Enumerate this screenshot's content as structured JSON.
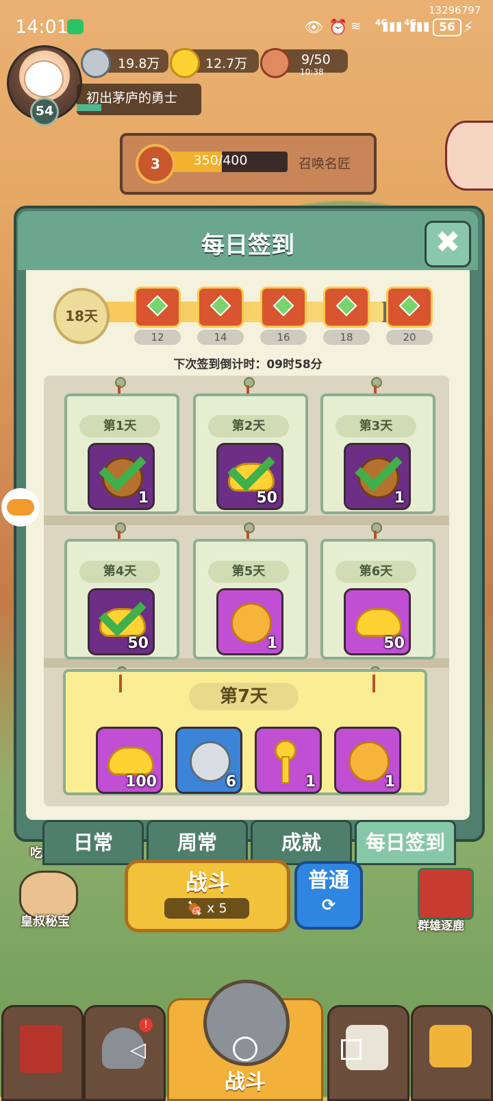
{
  "status_bar": {
    "time": "14:01",
    "account_id": "13296797",
    "battery": "56",
    "network_1": "4G",
    "network_2": "4G"
  },
  "player": {
    "level": "54",
    "title": "初出茅庐的勇士",
    "xp_progress": 0.2
  },
  "resources": {
    "silver": "19.8万",
    "gold": "12.7万",
    "stamina": "9/50",
    "stamina_timer": "10:38"
  },
  "summon": {
    "rank": "3",
    "progress_text": "350/400",
    "progress": 0.875,
    "label": "召唤名匠"
  },
  "dialog": {
    "title": "每日签到",
    "close_icon": "close-icon",
    "total_days": "18天",
    "progress_fraction": 0.9,
    "milestones": [
      "12",
      "14",
      "16",
      "18",
      "20"
    ],
    "countdown": "下次签到倒计时：09时58分",
    "days": [
      {
        "label": "第1天",
        "qty": "1",
        "icon": "bread-icon",
        "claimed": true
      },
      {
        "label": "第2天",
        "qty": "50",
        "icon": "gold-ingot-icon",
        "claimed": true
      },
      {
        "label": "第3天",
        "qty": "1",
        "icon": "bread-icon",
        "claimed": true
      },
      {
        "label": "第4天",
        "qty": "50",
        "icon": "gold-ingot-icon",
        "claimed": true
      },
      {
        "label": "第5天",
        "qty": "1",
        "icon": "heart-coin-icon",
        "claimed": false
      },
      {
        "label": "第6天",
        "qty": "50",
        "icon": "gold-ingot-icon",
        "claimed": false
      }
    ],
    "day7": {
      "label": "第7天",
      "items": [
        {
          "qty": "100",
          "icon": "gold-ingot-icon"
        },
        {
          "qty": "6",
          "icon": "silver-coin-icon"
        },
        {
          "qty": "1",
          "icon": "key-icon"
        },
        {
          "qty": "1",
          "icon": "heart-coin-icon"
        }
      ]
    }
  },
  "tabs": [
    "日常",
    "周常",
    "成就",
    "每日签到"
  ],
  "battle": {
    "button": "战斗",
    "cost": "x 5",
    "mode": "普通"
  },
  "side": {
    "left": "皇叔秘宝",
    "right": "群雄逐鹿",
    "left_partial": "吃"
  },
  "bottom_nav": {
    "center": "战斗"
  }
}
